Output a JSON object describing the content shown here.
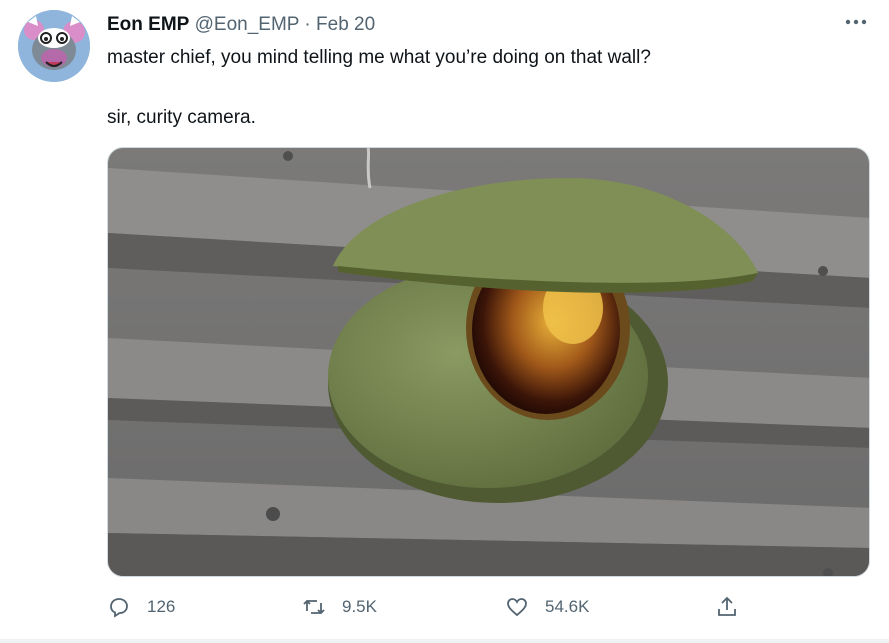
{
  "tweet": {
    "display_name": "Eon EMP",
    "handle": "@Eon_EMP",
    "separator": "·",
    "date": "Feb 20",
    "text_line1": "master chief, you mind telling me what you’re doing on that wall?",
    "text_line2": "sir, curity camera.",
    "avatar_icon": "cartoon-cow-avatar",
    "more_icon": "more-horizontal-icon"
  },
  "actions": {
    "reply": {
      "icon": "reply-icon",
      "count": "126"
    },
    "retweet": {
      "icon": "retweet-icon",
      "count": "9.5K"
    },
    "like": {
      "icon": "heart-icon",
      "count": "54.6K"
    },
    "share": {
      "icon": "share-icon"
    }
  },
  "colors": {
    "text_primary": "#0f1419",
    "text_secondary": "#536471",
    "camera_green": "#7a8a58"
  }
}
